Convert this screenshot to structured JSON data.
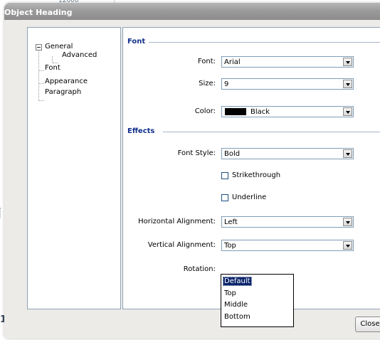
{
  "background": {
    "partial_number": "12000",
    "partial_letter": "1"
  },
  "dialog": {
    "title": "Object Heading"
  },
  "tree": {
    "items": [
      {
        "label": "General"
      },
      {
        "label": "Advanced"
      },
      {
        "label": "Font"
      },
      {
        "label": "Appearance"
      },
      {
        "label": "Paragraph"
      }
    ]
  },
  "font_section": {
    "heading": "Font",
    "font_label": "Font:",
    "font_value": "Arial",
    "size_label": "Size:",
    "size_value": "9",
    "color_label": "Color:",
    "color_value": "Black",
    "color_swatch": "#000000"
  },
  "effects_section": {
    "heading": "Effects",
    "font_style_label": "Font Style:",
    "font_style_value": "Bold",
    "strikethrough_label": "Strikethrough",
    "underline_label": "Underline",
    "h_align_label": "Horizontal Alignment:",
    "h_align_value": "Left",
    "v_align_label": "Vertical Alignment:",
    "v_align_value": "Top",
    "rotation_label": "Rotation:"
  },
  "v_align_dropdown": {
    "options": [
      "Default",
      "Top",
      "Middle",
      "Bottom"
    ],
    "highlighted": "Default"
  },
  "buttons": {
    "close": "Close"
  },
  "colors": {
    "section_heading": "#12308a",
    "selection": "#0a246a",
    "panel_border": "#8fa1b5"
  }
}
